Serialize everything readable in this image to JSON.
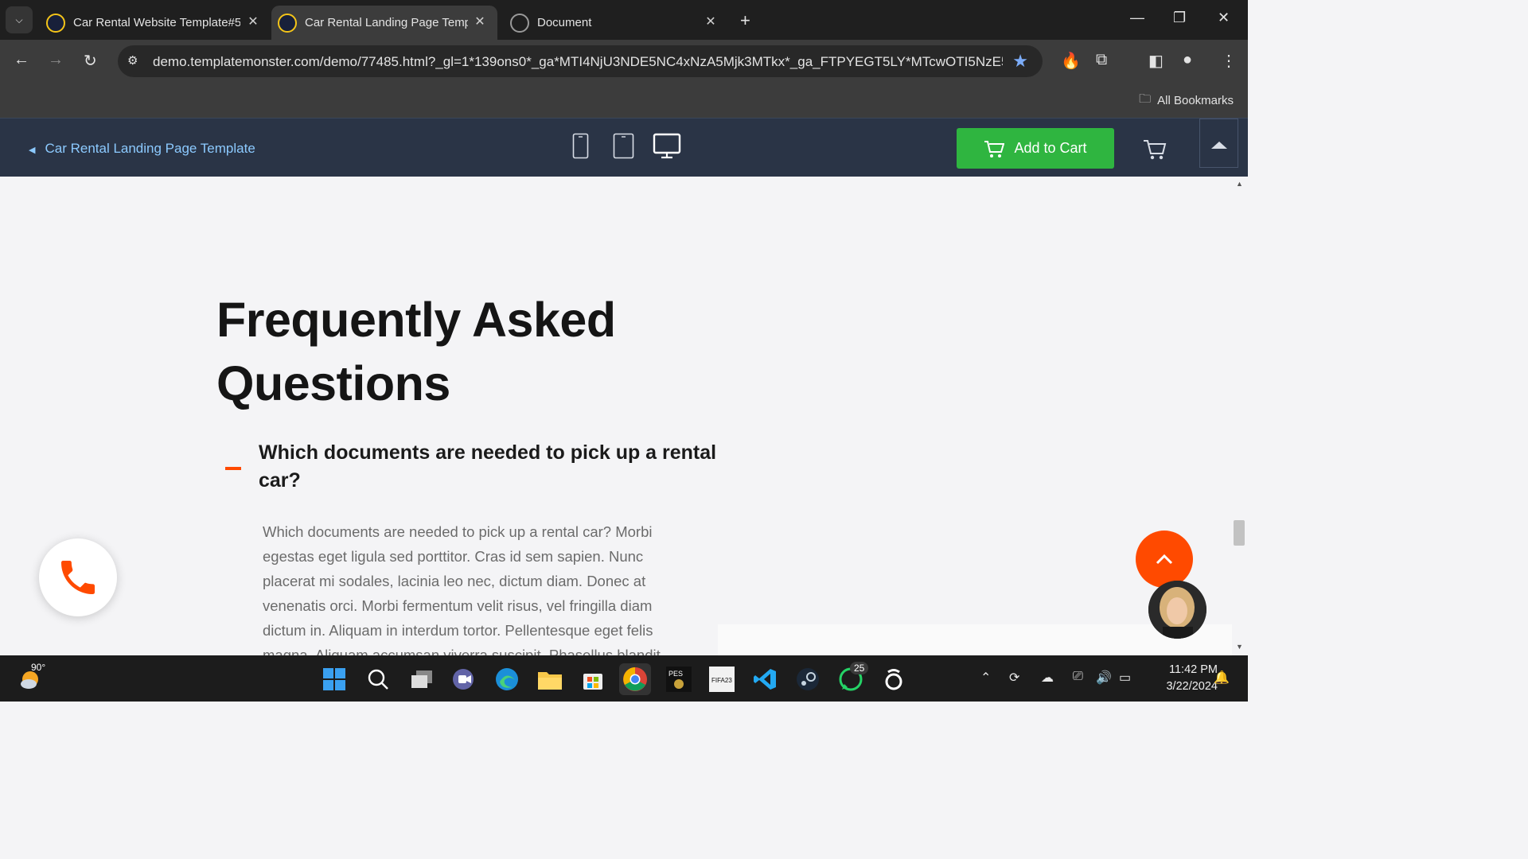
{
  "browser": {
    "tabs": [
      {
        "title": "Car Rental Website Template#5",
        "active": false,
        "favicon": "template-monster-icon"
      },
      {
        "title": "Car Rental Landing Page Templ",
        "active": true,
        "favicon": "template-monster-icon"
      },
      {
        "title": "Document",
        "active": false,
        "favicon": "globe-icon"
      }
    ],
    "url": "demo.templatemonster.com/demo/77485.html?_gl=1*139ons0*_ga*MTI4NjU3NDE5NC4xNzA5Mjk3MTkx*_ga_FTPYEGT5LY*MTcwOTI5NzE5...",
    "bookmarks_label": "All Bookmarks"
  },
  "template_bar": {
    "back_label": "Car Rental Landing Page Template",
    "add_to_cart_label": "Add to Cart"
  },
  "faq": {
    "title_line1": "Frequently Asked",
    "title_line2": "Questions",
    "question": "Which documents are needed to pick up a rental car?",
    "answer": "Which documents are needed to pick up a rental car? Morbi egestas eget ligula sed porttitor. Cras id sem sapien. Nunc placerat mi sodales, lacinia leo nec, dictum diam. Donec at venenatis orci. Morbi fermentum velit risus, vel fringilla diam dictum in. Aliquam in interdum tortor. Pellentesque eget felis magna. Aliquam accumsan viverra suscipit. Phasellus blandit"
  },
  "taskbar": {
    "temperature": "90°",
    "whatsapp_badge": "25",
    "time": "11:42 PM",
    "date": "3/22/2024"
  },
  "colors": {
    "accent_orange": "#ff4a00",
    "cart_green": "#2fb540",
    "link_blue": "#8ccaff"
  }
}
